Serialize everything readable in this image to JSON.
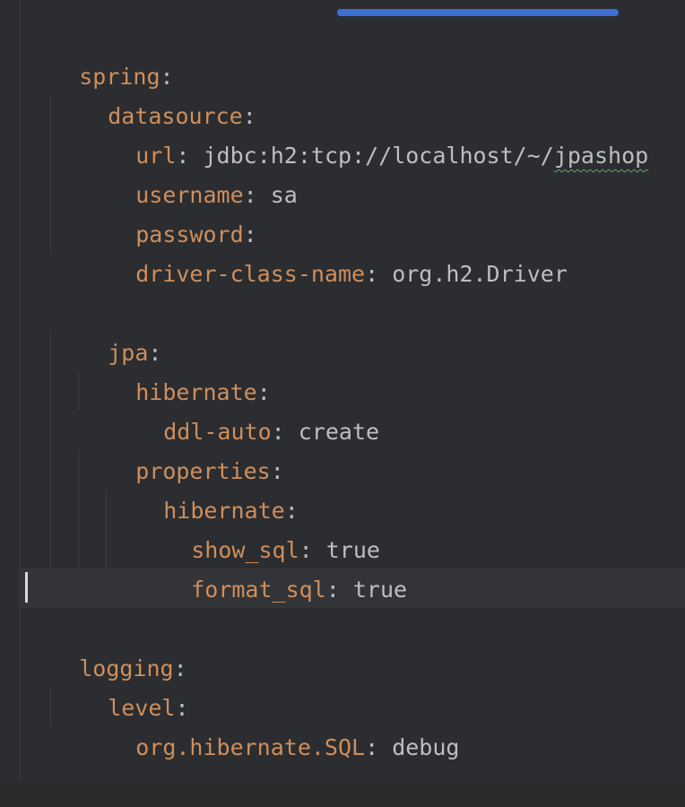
{
  "editor": {
    "lines": [
      {
        "key": "spring",
        "sep": ":",
        "value": ""
      },
      {
        "key": "datasource",
        "sep": ":",
        "value": ""
      },
      {
        "key": "url",
        "sep": ": ",
        "value_pre": "jdbc:h2:tcp://localhost/~/",
        "value_err": "jpashop"
      },
      {
        "key": "username",
        "sep": ": ",
        "value": "sa"
      },
      {
        "key": "password",
        "sep": ":",
        "value": ""
      },
      {
        "key": "driver-class-name",
        "sep": ": ",
        "value": "org.h2.Driver"
      },
      {
        "key": "jpa",
        "sep": ":",
        "value": ""
      },
      {
        "key": "hibernate",
        "sep": ":",
        "value": ""
      },
      {
        "key": "ddl-auto",
        "sep": ": ",
        "value": "create"
      },
      {
        "key": "properties",
        "sep": ":",
        "value": ""
      },
      {
        "key": "hibernate",
        "sep": ":",
        "value": ""
      },
      {
        "key": "show_sql",
        "sep": ": ",
        "value": "true"
      },
      {
        "key": "format_sql",
        "sep": ": ",
        "value": "true"
      },
      {
        "key": "logging",
        "sep": ":",
        "value": ""
      },
      {
        "key": "level",
        "sep": ":",
        "value": ""
      },
      {
        "key": "org.hibernate.SQL",
        "sep": ": ",
        "value": "debug"
      }
    ]
  },
  "colors": {
    "background": "#2b2d30",
    "key": "#cf8e5c",
    "text": "#bcbec4",
    "scroll_thumb": "#3f6fd6",
    "current_line": "#323438",
    "typo_squiggle": "#5fa866"
  }
}
